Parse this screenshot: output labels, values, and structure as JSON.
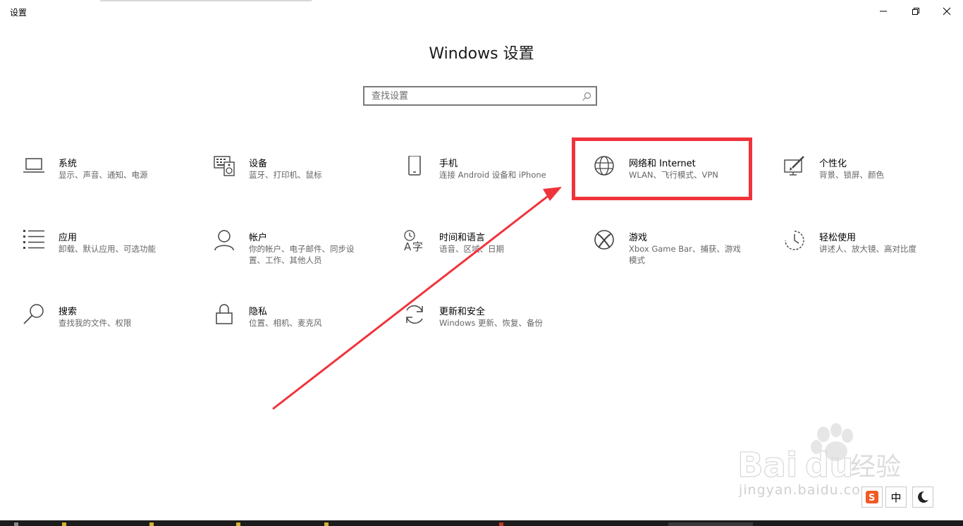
{
  "window": {
    "title": "设置",
    "controls": [
      "minimize",
      "restore",
      "close"
    ]
  },
  "heading": "Windows 设置",
  "search": {
    "placeholder": "查找设置"
  },
  "tiles": [
    {
      "name": "系统",
      "desc": "显示、声音、通知、电源",
      "icon": "laptop-icon"
    },
    {
      "name": "设备",
      "desc": "蓝牙、打印机、鼠标",
      "icon": "keyboard-speaker-icon"
    },
    {
      "name": "手机",
      "desc": "连接 Android 设备和 iPhone",
      "icon": "phone-icon"
    },
    {
      "name": "网络和 Internet",
      "desc": "WLAN、飞行模式、VPN",
      "icon": "globe-icon"
    },
    {
      "name": "个性化",
      "desc": "背景、锁屏、颜色",
      "icon": "brush-screen-icon"
    },
    {
      "name": "应用",
      "desc": "卸载、默认应用、可选功能",
      "icon": "app-list-icon"
    },
    {
      "name": "帐户",
      "desc": "你的帐户、电子邮件、同步设置、工作、其他人员",
      "icon": "person-icon"
    },
    {
      "name": "时间和语言",
      "desc": "语音、区域、日期",
      "icon": "time-language-icon"
    },
    {
      "name": "游戏",
      "desc": "Xbox Game Bar、捕获、游戏模式",
      "icon": "xbox-icon"
    },
    {
      "name": "轻松使用",
      "desc": "讲述人、放大镜、高对比度",
      "icon": "ease-of-access-icon"
    },
    {
      "name": "搜索",
      "desc": "查找我的文件、权限",
      "icon": "magnifier-icon"
    },
    {
      "name": "隐私",
      "desc": "位置、相机、麦克风",
      "icon": "lock-icon"
    },
    {
      "name": "更新和安全",
      "desc": "Windows 更新、恢复、备份",
      "icon": "update-sync-icon"
    }
  ],
  "watermark": {
    "text": "jingyan.baidu.com"
  },
  "tray": {
    "ime_label": "中",
    "icons": [
      "ime-s-icon",
      "moon-icon"
    ]
  },
  "colors": {
    "highlight": "#f0333b",
    "accent_text": "#000000",
    "desc_text": "#666666"
  }
}
